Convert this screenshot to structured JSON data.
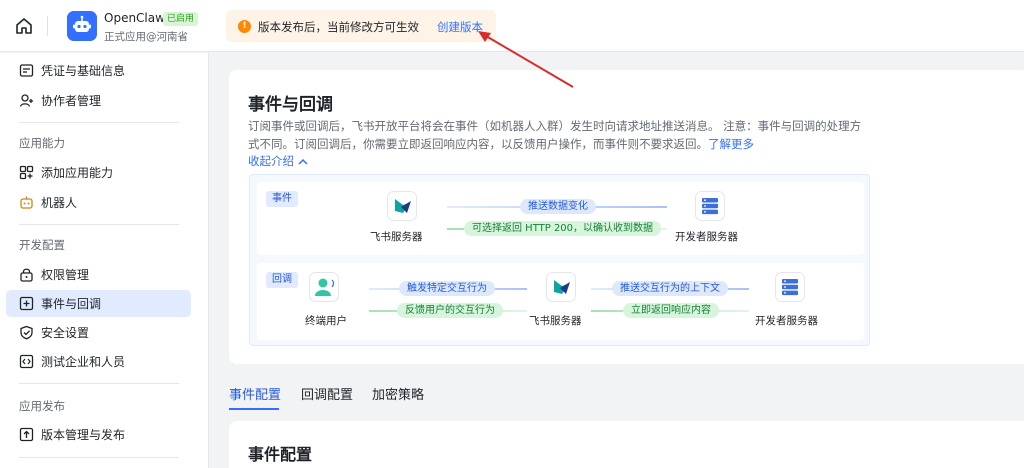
{
  "app": {
    "name": "OpenClaw",
    "status": "已启用",
    "subtitle": "正式应用@河南省"
  },
  "notice": {
    "text": "版本发布后，当前修改方可生效",
    "link": "创建版本"
  },
  "sidebar": {
    "top_items": [
      {
        "label": "凭证与基础信息",
        "icon": "credential-icon"
      },
      {
        "label": "协作者管理",
        "icon": "collaborator-icon"
      }
    ],
    "groups": [
      {
        "title": "应用能力",
        "items": [
          {
            "label": "添加应用能力",
            "icon": "add-capability-icon"
          },
          {
            "label": "机器人",
            "icon": "robot-icon"
          }
        ]
      },
      {
        "title": "开发配置",
        "items": [
          {
            "label": "权限管理",
            "icon": "permission-icon"
          },
          {
            "label": "事件与回调",
            "icon": "event-callback-icon",
            "active": true
          },
          {
            "label": "安全设置",
            "icon": "shield-icon"
          },
          {
            "label": "测试企业和人员",
            "icon": "test-code-icon"
          }
        ]
      },
      {
        "title": "应用发布",
        "items": [
          {
            "label": "版本管理与发布",
            "icon": "version-upload-icon"
          }
        ]
      }
    ]
  },
  "main": {
    "title": "事件与回调",
    "description": "订阅事件或回调后，飞书开放平台将会在事件（如机器人入群）发生时向请求地址推送消息。 注意：事件与回调的处理方式不同。订阅回调后，你需要立即返回响应内容，以反馈用户操作，而事件则不要求返回。",
    "learn_more": "了解更多",
    "collapse": "收起介绍",
    "diagram": {
      "event": {
        "tag": "事件",
        "source": "飞书服务器",
        "target": "开发者服务器",
        "push": "推送数据变化",
        "reply": "可选择返回 HTTP 200，以确认收到数据"
      },
      "callback": {
        "tag": "回调",
        "user": "终端用户",
        "server": "飞书服务器",
        "dev": "开发者服务器",
        "trigger": "触发特定交互行为",
        "feedback": "反馈用户的交互行为",
        "push_context": "推送交互行为的上下文",
        "respond": "立即返回响应内容"
      }
    },
    "tabs": [
      "事件配置",
      "回调配置",
      "加密策略"
    ],
    "active_tab": "事件配置",
    "section_title": "事件配置"
  },
  "colors": {
    "accent": "#3370ff",
    "active_bg": "#e1eaff",
    "notice_bg": "#fdf3e6",
    "warning": "#ff8800",
    "annotation_arrow": "#d92b2b"
  }
}
